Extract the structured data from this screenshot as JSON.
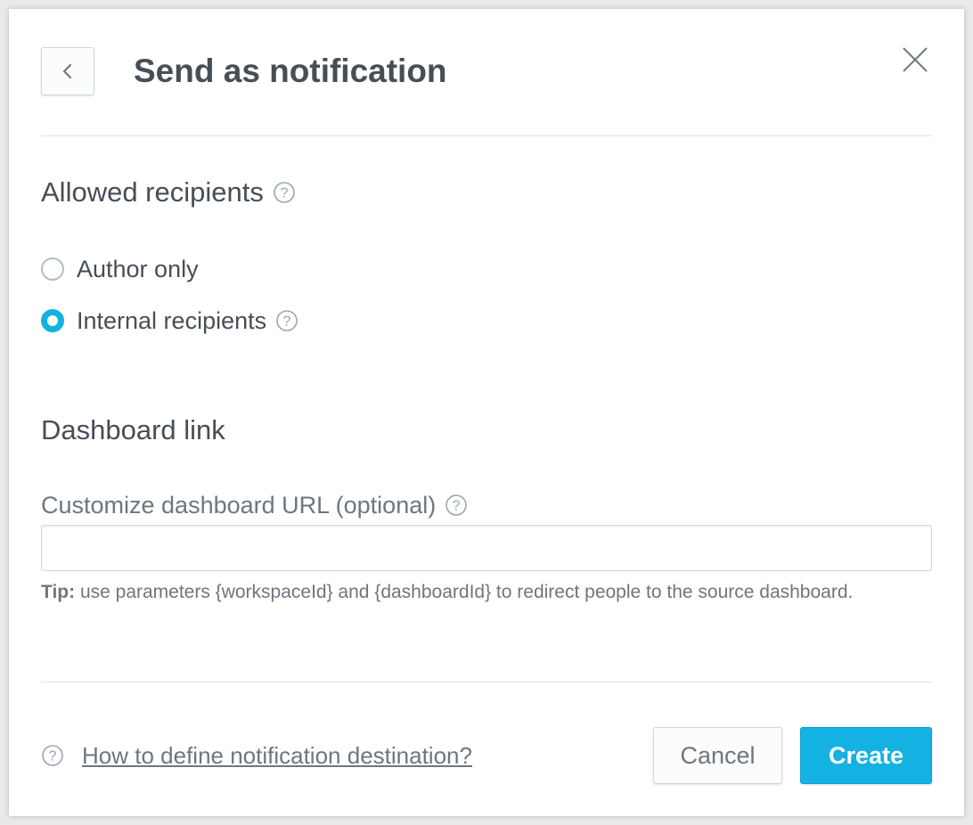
{
  "dialog": {
    "title": "Send as notification",
    "back_icon": "chevron-left-icon",
    "close_icon": "close-icon"
  },
  "recipients": {
    "title": "Allowed recipients",
    "help_icon": "help-icon",
    "options": [
      {
        "label": "Author only",
        "checked": false
      },
      {
        "label": "Internal recipients",
        "checked": true,
        "help_icon": "help-icon"
      }
    ]
  },
  "dashboard_link": {
    "title": "Dashboard link",
    "field_label": "Customize dashboard URL (optional)",
    "field_value": "",
    "field_placeholder": "",
    "tip_prefix": "Tip:",
    "tip_text": " use parameters {workspaceId} and {dashboardId} to redirect people to the source dashboard."
  },
  "footer": {
    "help_link": "How to define notification destination?",
    "cancel_label": "Cancel",
    "create_label": "Create"
  },
  "colors": {
    "accent": "#14b2e2",
    "text": "#464e56",
    "muted_text": "#6d7680",
    "border": "#ccd8e2"
  }
}
